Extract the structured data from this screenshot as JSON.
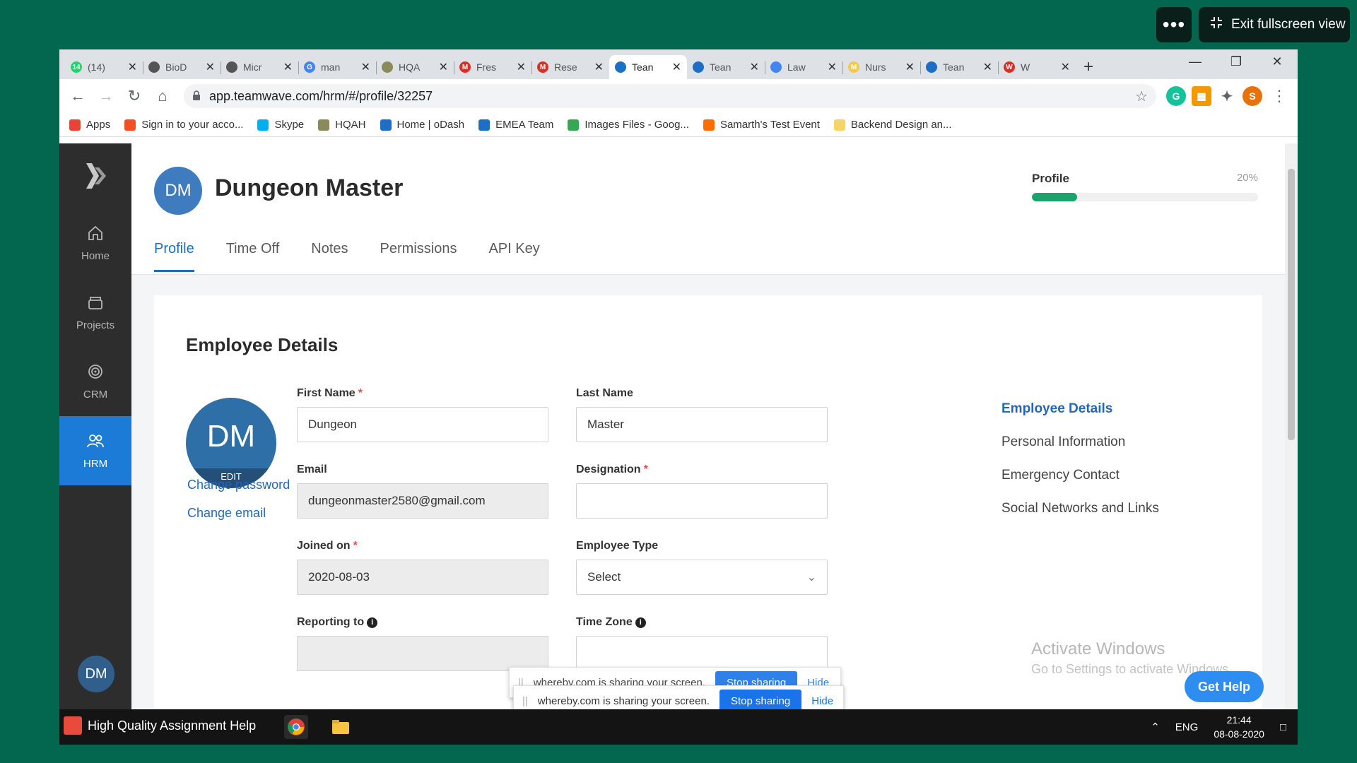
{
  "overlay": {
    "more_label": "•••",
    "exit_label": "Exit fullscreen view"
  },
  "browser": {
    "tabs": [
      {
        "label": "(14)",
        "favicon": "whatsapp-icon",
        "color": "#25d366",
        "glyph": "14"
      },
      {
        "label": "BioD",
        "favicon": "globe-icon",
        "color": "#555555",
        "glyph": ""
      },
      {
        "label": "Micr",
        "favicon": "globe-icon",
        "color": "#555555",
        "glyph": ""
      },
      {
        "label": "man",
        "favicon": "google-icon",
        "color": "#4285f4",
        "glyph": "G"
      },
      {
        "label": "HQA",
        "favicon": "hqah-icon",
        "color": "#8a8a5a",
        "glyph": ""
      },
      {
        "label": "Fres",
        "favicon": "gmail-icon",
        "color": "#d93025",
        "glyph": "M"
      },
      {
        "label": "Rese",
        "favicon": "gmail-icon",
        "color": "#d93025",
        "glyph": "M"
      },
      {
        "label": "Tean",
        "favicon": "teamwave-icon",
        "color": "#1c6fc4",
        "glyph": ""
      },
      {
        "label": "Tean",
        "favicon": "teamwave-icon",
        "color": "#1c6fc4",
        "glyph": ""
      },
      {
        "label": "Law",
        "favicon": "docs-icon",
        "color": "#4285f4",
        "glyph": ""
      },
      {
        "label": "Nurs",
        "favicon": "miro-icon",
        "color": "#f2c94c",
        "glyph": "M"
      },
      {
        "label": "Tean",
        "favicon": "teamwave-icon",
        "color": "#1c6fc4",
        "glyph": ""
      },
      {
        "label": "W",
        "favicon": "word-icon",
        "color": "#d93025",
        "glyph": "W"
      }
    ],
    "active_tab": 7,
    "url": "app.teamwave.com/hrm/#/profile/32257",
    "bookmarks": [
      {
        "label": "Apps",
        "icon": "apps-grid-icon",
        "color": "#ea4335"
      },
      {
        "label": "Sign in to your acco...",
        "icon": "microsoft-icon",
        "color": "#f25022"
      },
      {
        "label": "Skype",
        "icon": "skype-icon",
        "color": "#00aff0"
      },
      {
        "label": "HQAH",
        "icon": "hqah-icon",
        "color": "#8a8a5a"
      },
      {
        "label": "Home | oDash",
        "icon": "odash-icon",
        "color": "#1c6fc4"
      },
      {
        "label": "EMEA Team",
        "icon": "emea-icon",
        "color": "#1c6fc4"
      },
      {
        "label": "Images Files - Goog...",
        "icon": "drive-icon",
        "color": "#34a853"
      },
      {
        "label": "Samarth's Test Event",
        "icon": "event-icon",
        "color": "#ff6d00"
      },
      {
        "label": "Backend Design an...",
        "icon": "folder-icon",
        "color": "#f6d365"
      }
    ],
    "profile_initial": "S"
  },
  "sidebar": {
    "items": [
      {
        "label": "Home",
        "icon": "home-icon"
      },
      {
        "label": "Projects",
        "icon": "projects-icon"
      },
      {
        "label": "CRM",
        "icon": "crm-icon"
      },
      {
        "label": "HRM",
        "icon": "hrm-icon"
      }
    ],
    "active": 3,
    "user_initials": "DM"
  },
  "header": {
    "initials": "DM",
    "name": "Dungeon Master",
    "tabs": [
      "Profile",
      "Time Off",
      "Notes",
      "Permissions",
      "API Key"
    ],
    "active_tab": 0,
    "progress": {
      "label": "Profile",
      "value_text": "20%",
      "value": 0.2
    }
  },
  "details": {
    "title": "Employee Details",
    "avatar_initials": "DM",
    "avatar_edit": "EDIT",
    "change_password": "Change password",
    "change_email": "Change email",
    "fields": {
      "first_name": {
        "label": "First Name",
        "value": "Dungeon",
        "required": "*"
      },
      "last_name": {
        "label": "Last Name",
        "value": "Master"
      },
      "email": {
        "label": "Email",
        "value": "dungeonmaster2580@gmail.com"
      },
      "designation": {
        "label": "Designation",
        "value": "",
        "required": "*"
      },
      "joined_on": {
        "label": "Joined on",
        "value": "2020-08-03",
        "required": "*"
      },
      "employee_type": {
        "label": "Employee Type",
        "value": "Select"
      },
      "reporting_to": {
        "label": "Reporting to",
        "value": ""
      },
      "time_zone": {
        "label": "Time Zone",
        "value": ""
      }
    },
    "sections": [
      "Employee Details",
      "Personal Information",
      "Emergency Contact",
      "Social Networks and Links"
    ]
  },
  "share": {
    "message_back": "whereby.com is sharing your screen.",
    "message": "whereby.com is sharing your screen.",
    "stop_label": "Stop sharing",
    "hide_label": "Hide"
  },
  "watermark": {
    "line1": "Activate Windows",
    "line2": "Go to Settings to activate Windows."
  },
  "get_help": "Get Help",
  "taskbar": {
    "app_label": "High Quality Assignment Help",
    "lang": "ENG",
    "time": "21:44",
    "date": "08-08-2020"
  }
}
